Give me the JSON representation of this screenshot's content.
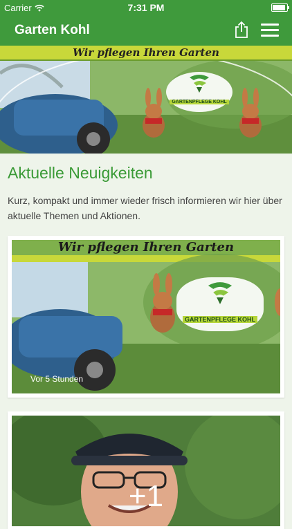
{
  "status": {
    "carrier": "Carrier",
    "time": "7:31 PM",
    "battery_level": 1.0
  },
  "navbar": {
    "title": "Garten Kohl",
    "share_icon": "share-icon",
    "menu_icon": "hamburger-menu-icon"
  },
  "hero": {
    "slogan": "Wir pflegen Ihren Garten",
    "logo_text": "GARTENPFLEGE KOHL"
  },
  "main": {
    "heading": "Aktuelle Neuigkeiten",
    "intro": "Kurz, kompakt und immer wieder frisch informieren wir hier über aktuelle Themen und Aktionen."
  },
  "posts": [
    {
      "slogan": "Wir pflegen Ihren Garten",
      "logo_text": "GARTENPFLEGE KOHL",
      "time": "Vor 5 Stunden"
    },
    {
      "count": "+1"
    }
  ],
  "colors": {
    "brand": "#3f9a3c",
    "accent": "#b6d63a"
  }
}
